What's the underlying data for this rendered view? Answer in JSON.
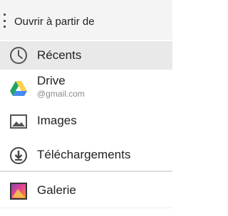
{
  "header": {
    "title": "Ouvrir à partir de"
  },
  "items": [
    {
      "label": "Récents",
      "icon": "clock-icon",
      "selected": true
    },
    {
      "label": "Drive",
      "sublabel": "@gmail.com",
      "icon": "google-drive-icon"
    },
    {
      "label": "Images",
      "icon": "image-icon"
    },
    {
      "label": "Téléchargements",
      "icon": "download-icon"
    },
    {
      "label": "Galerie",
      "icon": "gallery-icon"
    }
  ],
  "colors": {
    "header_bg": "#f4f4f4",
    "selected_bg": "#e9e9e9",
    "drive_green": "#1fa463",
    "drive_yellow": "#ffd04b",
    "drive_blue": "#4688f4"
  }
}
